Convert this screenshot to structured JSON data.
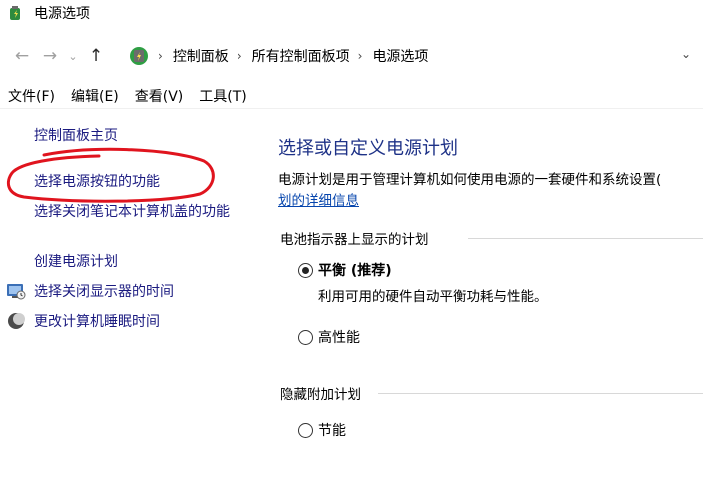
{
  "window": {
    "title": "电源选项"
  },
  "nav": {
    "back_icon": "back-arrow-icon",
    "forward_icon": "forward-arrow-icon",
    "recent_icon": "chevron-down-icon",
    "up_icon": "up-arrow-icon"
  },
  "breadcrumb": [
    "控制面板",
    "所有控制面板项",
    "电源选项"
  ],
  "menu": [
    "文件(F)",
    "编辑(E)",
    "查看(V)",
    "工具(T)"
  ],
  "left_pane": {
    "home": "控制面板主页",
    "power_button": "选择电源按钮的功能",
    "lid": "选择关闭笔记本计算机盖的功能",
    "create_plan": "创建电源计划",
    "display_off": "选择关闭显示器的时间",
    "sleep": "更改计算机睡眠时间"
  },
  "main": {
    "title": "选择或自定义电源计划",
    "description": "电源计划是用于管理计算机如何使用电源的一套硬件和系统设置(",
    "description_link": "划的详细信息",
    "battery_group": "电池指示器上显示的计划",
    "hidden_group": "隐藏附加计划",
    "plans": {
      "balanced": {
        "name": "平衡 (推荐)",
        "desc": "利用可用的硬件自动平衡功耗与性能。",
        "selected": true
      },
      "high": {
        "name": "高性能",
        "selected": false
      },
      "saver": {
        "name": "节能",
        "selected": false
      }
    }
  },
  "colors": {
    "link": "#1b1b80",
    "heading": "#1e3287",
    "annotation": "#e0141e"
  }
}
